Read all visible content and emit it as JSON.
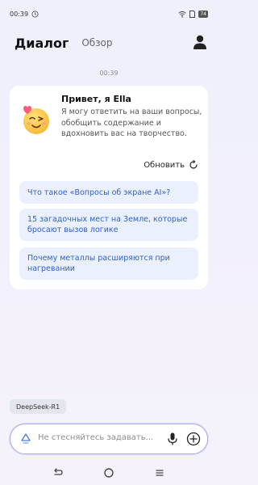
{
  "status_bar": {
    "time": "00:39",
    "battery": "74"
  },
  "header": {
    "tab_active": "Диалог",
    "tab_other": "Обзор"
  },
  "timestamp": "00:39",
  "greeting": {
    "title": "Привет, я Ella",
    "body": "Я могу ответить на ваши вопросы, обобщить содержание и вдохновить вас на творчество.",
    "refresh_label": "Обновить"
  },
  "suggestions": [
    {
      "text": "Что такое «Вопросы об экране AI»?"
    },
    {
      "text": "15 загадочных мест на Земле, которые бросают вызов логике"
    },
    {
      "text": "Почему металлы расширяются при нагревании"
    }
  ],
  "model_chip": "DeepSeek-R1",
  "input": {
    "placeholder": "Не стесняйтесь задавать..."
  },
  "icons": {
    "profile": "person-icon",
    "refresh": "refresh-icon",
    "mic": "microphone-icon",
    "plus": "plus-circle-icon",
    "nav_back": "back-icon",
    "nav_home": "home-icon",
    "nav_menu": "menu-icon"
  },
  "colors": {
    "accent": "#2f5fd0",
    "suggestion_bg": "#eaf0fd"
  }
}
